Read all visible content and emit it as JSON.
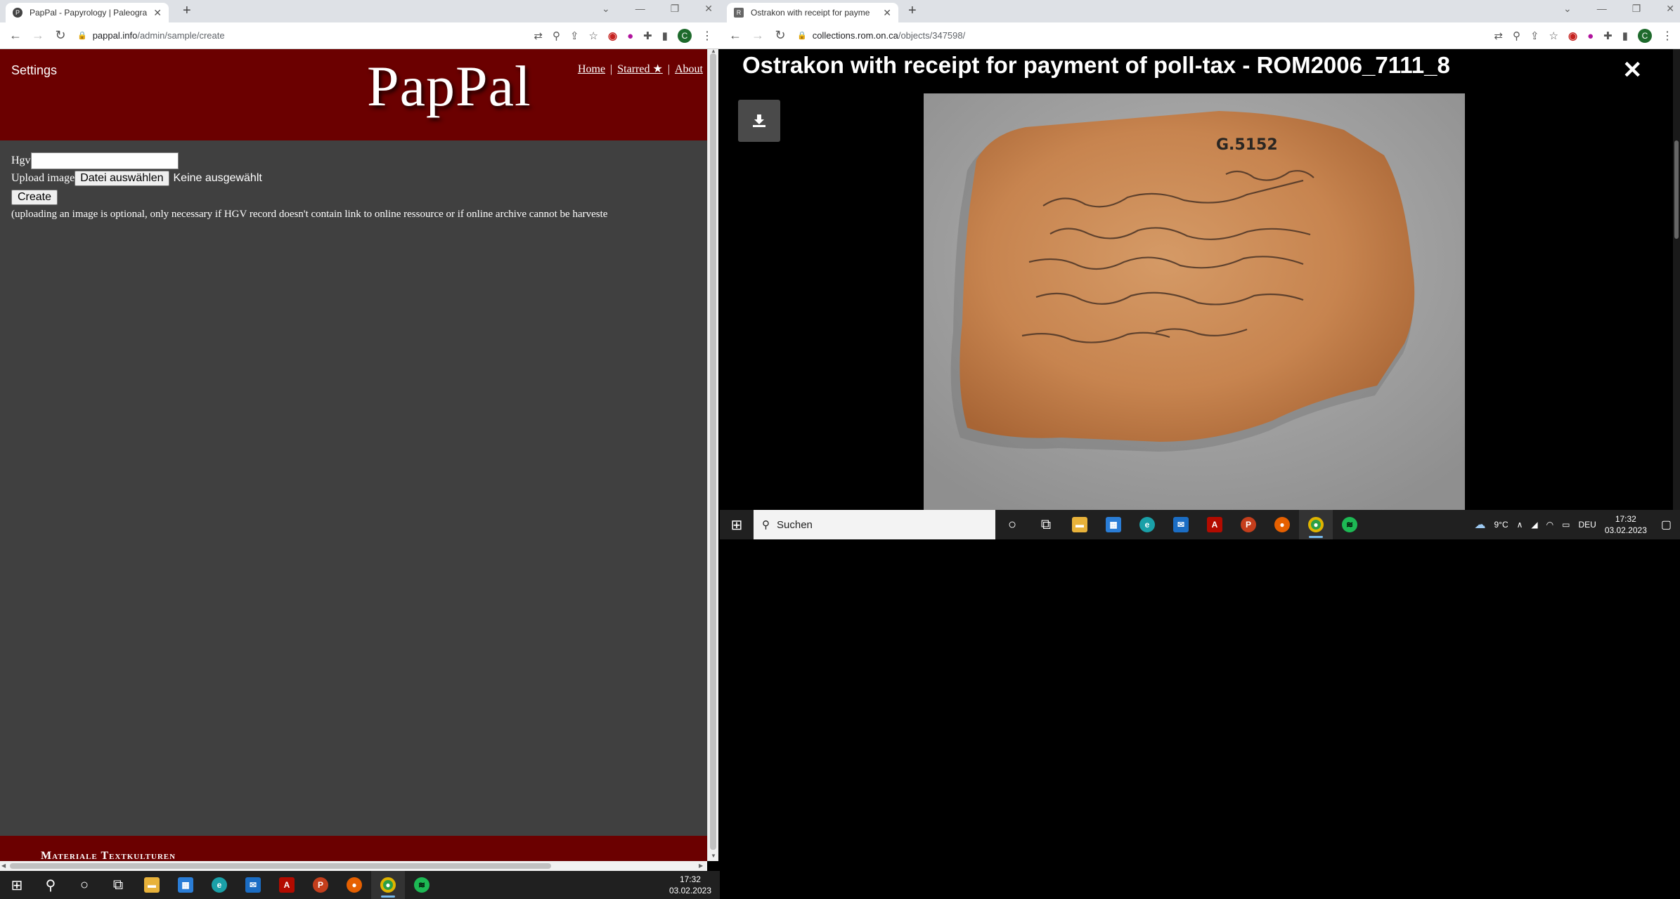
{
  "left_browser": {
    "tab": {
      "title": "PapPal - Papyrology | Paleograph",
      "favicon": "P"
    },
    "url_host": "pappal.info",
    "url_path": "/admin/sample/create"
  },
  "pappal": {
    "settings_label": "Settings",
    "logo": "PapPal",
    "nav": {
      "home": "Home",
      "starred": "Starred ★",
      "about": "About",
      "sep": "|"
    },
    "form": {
      "hgv_label": "Hgv",
      "hgv_value": "",
      "upload_label": "Upload image",
      "file_button": "Datei auswählen",
      "no_file": "Keine ausgewählt",
      "create_button": "Create",
      "note": "(uploading an image is optional, only necessary if HGV record doesn't contain link to online ressource or if online archive cannot be harveste"
    },
    "footer_text": "Materiale Textkulturen"
  },
  "right_browser": {
    "tab": {
      "title": "Ostrakon with receipt for payme",
      "favicon": "R"
    },
    "url_host": "collections.rom.on.ca",
    "url_path": "/objects/347598/"
  },
  "rom": {
    "title": "Ostrakon with receipt for payment of poll-tax - ROM2006_7111_8",
    "close_symbol": "✕",
    "object_label": "G.5152"
  },
  "taskbar_left": {
    "time": "17:32",
    "date": "03.02.2023"
  },
  "taskbar_right": {
    "search_placeholder": "Suchen",
    "weather": "9°C",
    "lang": "DEU",
    "time": "17:32",
    "date": "03.02.2023"
  },
  "colors": {
    "pappal_red": "#6b0000",
    "pappal_body": "#404040",
    "taskbar": "#202020"
  }
}
